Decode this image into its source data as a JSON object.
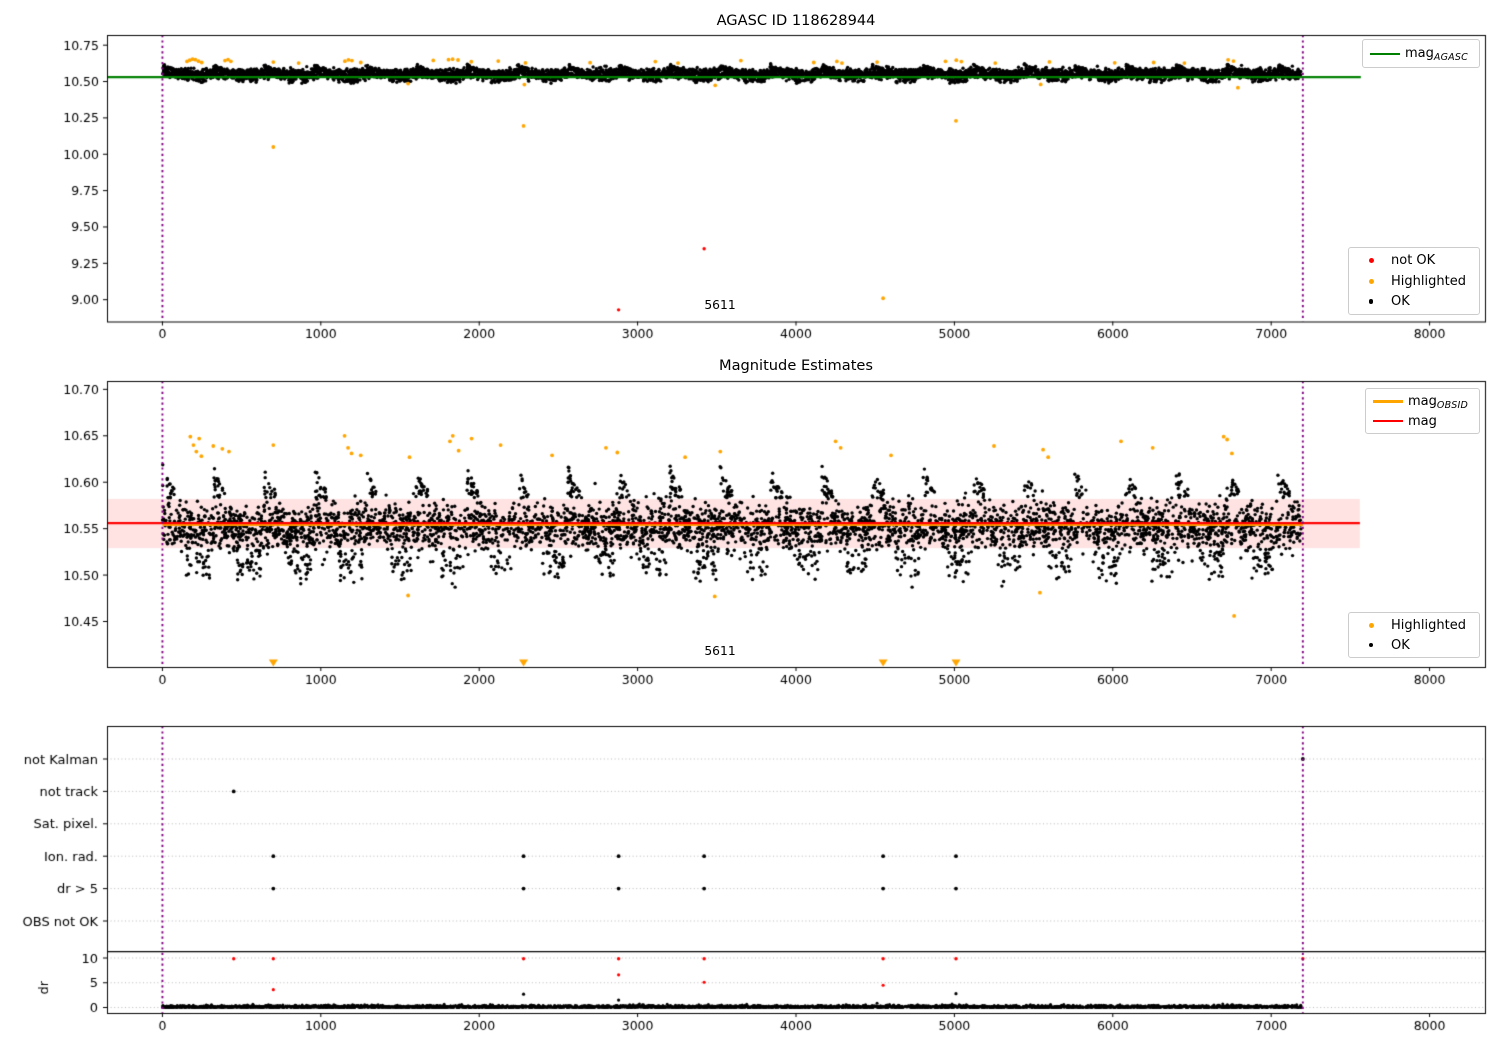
{
  "colors": {
    "ok": "#000000",
    "not_ok": "#ff0000",
    "highlighted": "#ffa500",
    "mag_agasc_line": "#008000",
    "mag_line": "#ff0000",
    "mag_obsid_line": "#ffa500",
    "obsid_interval_line": "#800080",
    "band_fill": "rgba(255,0,0,0.11)",
    "grid": "#b0b0b0",
    "spine": "#000000"
  },
  "chart_data": [
    {
      "id": "agasc_mag",
      "type": "scatter",
      "title": "AGASC ID 118628944",
      "xlim": [
        -350,
        8350
      ],
      "ylim": [
        8.85,
        10.82
      ],
      "x_ticks": [
        0,
        1000,
        2000,
        3000,
        4000,
        5000,
        6000,
        7000,
        8000
      ],
      "x_tick_labels": [
        "0",
        "1000",
        "2000",
        "3000",
        "4000",
        "5000",
        "6000",
        "7000",
        "8000"
      ],
      "y_ticks": [
        10.75,
        10.5,
        10.25,
        10.0,
        9.75,
        9.5,
        9.25,
        9.0
      ],
      "y_tick_labels": [
        "10.75",
        "10.50",
        "10.25",
        "10.00",
        "9.75",
        "9.50",
        "9.25",
        "9.00"
      ],
      "obsid_interval_lines": [
        0,
        7200
      ],
      "agasc_mag_line": {
        "y": 10.531,
        "x0": -350,
        "x1": 7566
      },
      "annotation": {
        "text": "5611",
        "x": 3520,
        "y": 8.95
      },
      "ok_scatter_summary": {
        "x0": 0,
        "x1": 7190,
        "n": 7000,
        "center": 10.5535,
        "sigma": 0.016,
        "ymin": 10.488,
        "ymax": 10.632,
        "cluster_period": 320
      },
      "highlighted_points": [
        [
          155,
          10.638
        ],
        [
          172,
          10.647
        ],
        [
          190,
          10.654
        ],
        [
          208,
          10.65
        ],
        [
          228,
          10.64
        ],
        [
          248,
          10.631
        ],
        [
          395,
          10.644
        ],
        [
          414,
          10.651
        ],
        [
          432,
          10.639
        ],
        [
          700,
          10.634
        ],
        [
          860,
          10.627
        ],
        [
          1152,
          10.64
        ],
        [
          1174,
          10.649
        ],
        [
          1196,
          10.644
        ],
        [
          1252,
          10.631
        ],
        [
          1710,
          10.645
        ],
        [
          1806,
          10.65
        ],
        [
          1832,
          10.654
        ],
        [
          1866,
          10.648
        ],
        [
          1950,
          10.636
        ],
        [
          2120,
          10.641
        ],
        [
          2292,
          10.628
        ],
        [
          2700,
          10.63
        ],
        [
          3112,
          10.637
        ],
        [
          3255,
          10.627
        ],
        [
          3652,
          10.644
        ],
        [
          4112,
          10.631
        ],
        [
          4258,
          10.638
        ],
        [
          4290,
          10.627
        ],
        [
          4512,
          10.634
        ],
        [
          4944,
          10.639
        ],
        [
          5012,
          10.647
        ],
        [
          5044,
          10.637
        ],
        [
          5258,
          10.627
        ],
        [
          5600,
          10.635
        ],
        [
          6012,
          10.629
        ],
        [
          6258,
          10.631
        ],
        [
          6452,
          10.627
        ],
        [
          6728,
          10.649
        ],
        [
          6762,
          10.641
        ],
        [
          1551,
          10.486
        ],
        [
          2285,
          10.479
        ],
        [
          3490,
          10.474
        ],
        [
          5545,
          10.48
        ],
        [
          6790,
          10.458
        ]
      ],
      "highlighted_outliers": [
        [
          700,
          10.05
        ],
        [
          2280,
          10.195
        ],
        [
          4550,
          9.01
        ],
        [
          5010,
          10.23
        ]
      ],
      "not_ok_outliers": [
        [
          2880,
          8.93
        ],
        [
          3420,
          9.35
        ]
      ],
      "legend_line": {
        "label_base": "mag",
        "label_sub": "AGASC"
      },
      "legend_markers": {
        "items": [
          {
            "name": "not OK"
          },
          {
            "name": "Highlighted"
          },
          {
            "name": "OK"
          }
        ]
      }
    },
    {
      "id": "magnitude_estimates",
      "type": "scatter",
      "title": "Magnitude Estimates",
      "xlim": [
        -350,
        8350
      ],
      "ylim": [
        10.401,
        10.709
      ],
      "x_ticks": [
        0,
        1000,
        2000,
        3000,
        4000,
        5000,
        6000,
        7000,
        8000
      ],
      "x_tick_labels": [
        "0",
        "1000",
        "2000",
        "3000",
        "4000",
        "5000",
        "6000",
        "7000",
        "8000"
      ],
      "y_ticks": [
        10.7,
        10.65,
        10.6,
        10.55,
        10.5,
        10.45
      ],
      "y_tick_labels": [
        "10.70",
        "10.65",
        "10.60",
        "10.55",
        "10.50",
        "10.45"
      ],
      "obsid_interval_lines": [
        0,
        7200
      ],
      "mag_line": {
        "y": 10.556,
        "x0": -350,
        "x1": 7560
      },
      "mag_obsid_line": {
        "y": 10.5545,
        "x0": 0,
        "x1": 7200
      },
      "mag_uncertainty_band": {
        "ylo": 10.529,
        "yhi": 10.582,
        "x0": -350,
        "x1": 7560
      },
      "annotation": {
        "text": "5611",
        "x": 3520,
        "y": 10.417
      },
      "ok_scatter_summary": {
        "x0": 0,
        "x1": 7190,
        "n": 5000,
        "center": 10.552,
        "sigma": 0.013,
        "ymin": 10.487,
        "ymax": 10.622,
        "cluster_period": 320
      },
      "highlighted_points": [
        [
          176,
          10.649
        ],
        [
          196,
          10.64
        ],
        [
          214,
          10.633
        ],
        [
          232,
          10.647
        ],
        [
          246,
          10.628
        ],
        [
          321,
          10.639
        ],
        [
          378,
          10.636
        ],
        [
          420,
          10.633
        ],
        [
          700,
          10.64
        ],
        [
          1150,
          10.65
        ],
        [
          1172,
          10.637
        ],
        [
          1194,
          10.631
        ],
        [
          1252,
          10.629
        ],
        [
          1560,
          10.627
        ],
        [
          1815,
          10.644
        ],
        [
          1833,
          10.65
        ],
        [
          1870,
          10.634
        ],
        [
          1952,
          10.647
        ],
        [
          2135,
          10.64
        ],
        [
          2460,
          10.629
        ],
        [
          2800,
          10.637
        ],
        [
          2872,
          10.632
        ],
        [
          3300,
          10.627
        ],
        [
          3522,
          10.633
        ],
        [
          4250,
          10.644
        ],
        [
          4282,
          10.637
        ],
        [
          4600,
          10.629
        ],
        [
          5250,
          10.639
        ],
        [
          5560,
          10.635
        ],
        [
          5592,
          10.627
        ],
        [
          6052,
          10.644
        ],
        [
          6252,
          10.637
        ],
        [
          6700,
          10.649
        ],
        [
          6722,
          10.646
        ],
        [
          6752,
          10.631
        ],
        [
          1551,
          10.478
        ],
        [
          3487,
          10.477
        ],
        [
          5540,
          10.481
        ],
        [
          6766,
          10.456
        ]
      ],
      "clipped_low_markers": {
        "symbol": "triangle-down",
        "x": [
          700,
          2280,
          4550,
          5010
        ]
      },
      "legend_lines": {
        "items": [
          {
            "label_base": "mag",
            "label_sub": "OBSID"
          },
          {
            "label_base": "mag",
            "label_sub": ""
          }
        ]
      },
      "legend_markers": {
        "items": [
          {
            "name": "Highlighted"
          },
          {
            "name": "OK"
          }
        ]
      }
    },
    {
      "id": "flags_and_dr",
      "type": "scatter",
      "xlim": [
        -350,
        8350
      ],
      "x_ticks": [
        0,
        1000,
        2000,
        3000,
        4000,
        5000,
        6000,
        7000,
        8000
      ],
      "x_tick_labels": [
        "0",
        "1000",
        "2000",
        "3000",
        "4000",
        "5000",
        "6000",
        "7000",
        "8000"
      ],
      "categories": [
        "not Kalman",
        "not track",
        "Sat. pixel.",
        "Ion. rad.",
        "dr > 5",
        "OBS not OK"
      ],
      "dr_axis": {
        "label": "dr",
        "ticks": [
          10,
          5,
          0
        ],
        "tick_labels": [
          "10",
          "5",
          "0"
        ]
      },
      "obsid_interval_lines": [
        0,
        7200
      ],
      "separator_line_dr": 11.3,
      "flags_black": {
        "not Kalman": [
          7200
        ],
        "not track": [
          450
        ],
        "Sat. pixel.": [],
        "Ion. rad.": [
          700,
          2280,
          2880,
          3420,
          4550,
          5010
        ],
        "dr > 5": [
          700,
          2280,
          2880,
          3420,
          4550,
          5010
        ],
        "OBS not OK": []
      },
      "dr_red_clamped_at_10": [
        450,
        700,
        2280,
        2880,
        3420,
        4550,
        5010,
        7200
      ],
      "dr_red_points": [
        [
          700,
          3.6
        ],
        [
          2880,
          6.6
        ],
        [
          3420,
          5.1
        ],
        [
          4550,
          4.5
        ]
      ],
      "dr_black_points": [
        [
          2280,
          2.7
        ],
        [
          2880,
          1.5
        ],
        [
          5010,
          2.8
        ]
      ],
      "dr_ok_band_summary": {
        "x0": 0,
        "x1": 7190,
        "n": 3600,
        "typical_max": 0.7
      }
    }
  ]
}
